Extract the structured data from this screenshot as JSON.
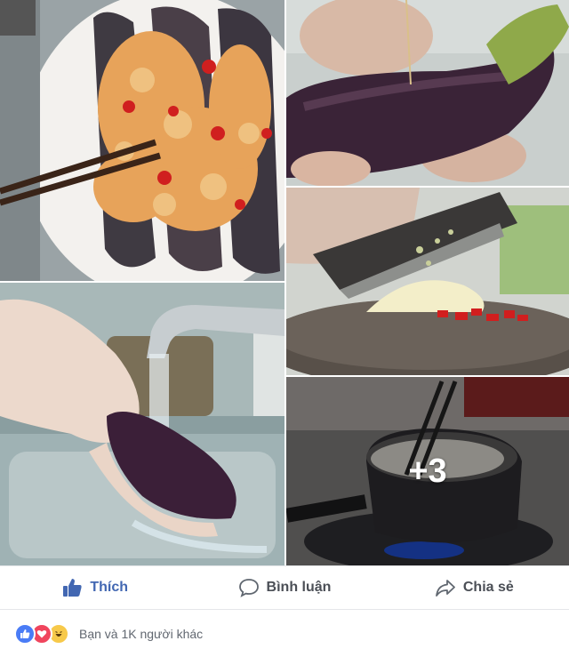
{
  "photos": {
    "more_count": "+3"
  },
  "actions": {
    "like_label": "Thích",
    "comment_label": "Bình luận",
    "share_label": "Chia sẻ"
  },
  "reactions": {
    "icons": [
      "like-icon",
      "love-icon",
      "haha-icon"
    ],
    "summary": "Bạn và 1K người khác"
  },
  "colors": {
    "like_blue": "#4267b2",
    "action_gray": "#4b4f56",
    "love_red": "#f0455d",
    "haha_yellow": "#f7c94a"
  }
}
